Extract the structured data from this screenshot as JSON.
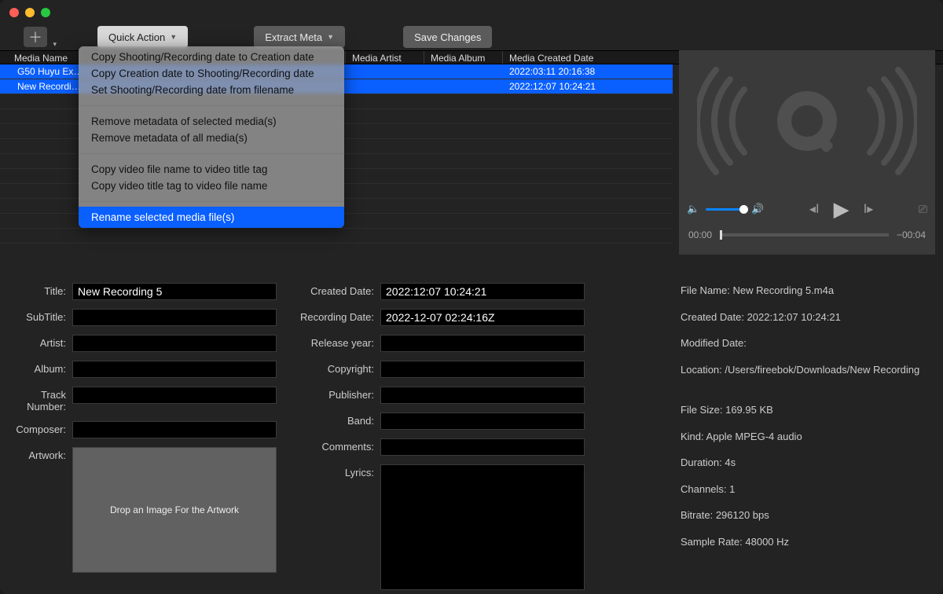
{
  "toolbar": {
    "quick_action": "Quick Action",
    "extract_meta": "Extract Meta",
    "save_changes": "Save Changes"
  },
  "columns": {
    "name": "Media Name",
    "artist": "Media Artist",
    "album": "Media Album",
    "created": "Media Created Date"
  },
  "rows": [
    {
      "name": "G50 Huyu Ex…3.",
      "artist": "",
      "album": "",
      "created": "2022:03:11 20:16:38"
    },
    {
      "name": "New Recordi…5.m",
      "artist": "",
      "album": "",
      "created": "2022:12:07 10:24:21"
    }
  ],
  "dropdown": {
    "g1a": "Copy Shooting/Recording date to Creation date",
    "g1b": "Copy Creation date to Shooting/Recording date",
    "g1c": "Set Shooting/Recording date from filename",
    "g2a": "Remove metadata of selected media(s)",
    "g2b": "Remove metadata of all media(s)",
    "g3a": "Copy video file name to video title tag",
    "g3b": "Copy video title tag to video file name",
    "g4a": "Rename selected media file(s)"
  },
  "preview": {
    "elapsed": "00:00",
    "remaining": "−00:04"
  },
  "form_labels": {
    "title": "Title:",
    "subtitle": "SubTitle:",
    "artist": "Artist:",
    "album": "Album:",
    "track": "Track Number:",
    "composer": "Composer:",
    "artwork": "Artwork:",
    "artwork_drop": "Drop an Image For the Artwork",
    "created": "Created Date:",
    "recording": "Recording Date:",
    "release": "Release year:",
    "copyright": "Copyright:",
    "publisher": "Publisher:",
    "band": "Band:",
    "comments": "Comments:",
    "lyrics": "Lyrics:"
  },
  "form_values": {
    "title": "New Recording 5",
    "created": "2022:12:07 10:24:21",
    "recording": "2022-12-07 02:24:16Z"
  },
  "info": {
    "filename_l": "File Name:",
    "filename_v": "New Recording 5.m4a",
    "created_l": "Created Date:",
    "created_v": "2022:12:07 10:24:21",
    "modified_l": "Modified Date:",
    "modified_v": "",
    "location_l": "Location:",
    "location_v": "/Users/fireebok/Downloads/New Recording",
    "filesize_l": "File Size:",
    "filesize_v": "169.95 KB",
    "kind_l": "Kind:",
    "kind_v": "Apple MPEG-4 audio",
    "duration_l": "Duration:",
    "duration_v": "4s",
    "channels_l": "Channels:",
    "channels_v": "1",
    "bitrate_l": "Bitrate:",
    "bitrate_v": "296120 bps",
    "samplerate_l": "Sample Rate:",
    "samplerate_v": "48000 Hz"
  }
}
